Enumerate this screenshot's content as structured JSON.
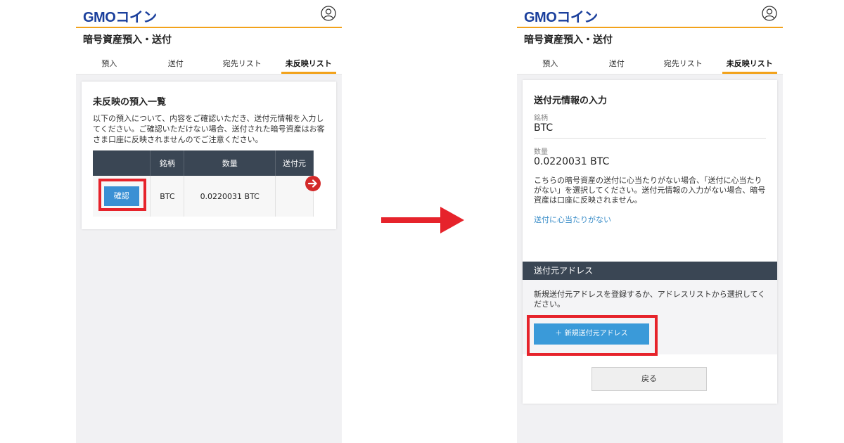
{
  "brand": {
    "logo_gmo": "GMO",
    "logo_coin": "コイン"
  },
  "page_title": "暗号資産預入・送付",
  "tabs": [
    "預入",
    "送付",
    "宛先リスト",
    "未反映リスト"
  ],
  "left": {
    "heading": "未反映の預入一覧",
    "description": "以下の預入について、内容をご確認いただき、送付元情報を入力してください。ご確認いただけない場合、送付された暗号資産はお客さま口座に反映されませんのでご注意ください。",
    "table": {
      "headers": [
        "",
        "銘柄",
        "数量",
        "送付元"
      ],
      "row": {
        "button": "確認",
        "symbol": "BTC",
        "amount": "0.0220031 BTC",
        "sender": ""
      }
    }
  },
  "right": {
    "heading": "送付元情報の入力",
    "symbol_label": "銘柄",
    "symbol_value": "BTC",
    "amount_label": "数量",
    "amount_value": "0.0220031 BTC",
    "note": "こちらの暗号資産の送付に心当たりがない場合、「送付に心当たりがない」を選択してください。送付元情報の入力がない場合、暗号資産は口座に反映されません。",
    "link": "送付に心当たりがない",
    "section_title": "送付元アドレス",
    "section_desc": "新規送付元アドレスを登録するか、アドレスリストから選択してください。",
    "add_button": "＋ 新規送付元アドレス",
    "back_button": "戻る"
  },
  "colors": {
    "accent": "#f2a21b",
    "highlight": "#e6232b",
    "button_blue": "#3a90d4",
    "header_dark": "#3a4654"
  }
}
